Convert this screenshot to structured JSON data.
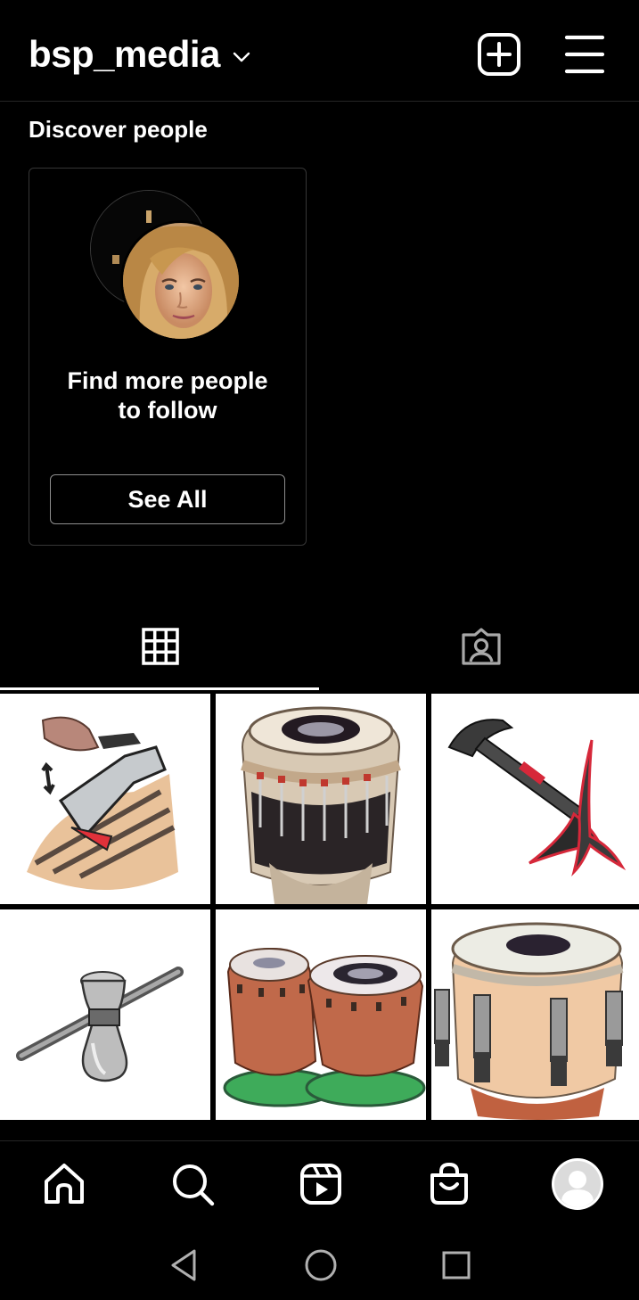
{
  "header": {
    "username": "bsp_media",
    "account_chevron_icon": "chevron-down-icon",
    "new_post_icon": "plus-square-icon",
    "menu_icon": "hamburger-menu-icon"
  },
  "discover": {
    "title": "Discover people",
    "card": {
      "text_line1": "Find more people",
      "text_line2": "to follow",
      "see_all_label": "See All"
    }
  },
  "tabs": [
    {
      "name": "posts-grid",
      "icon": "grid-icon",
      "active": true
    },
    {
      "name": "tagged",
      "icon": "tagged-person-icon",
      "active": false
    }
  ],
  "posts": [
    {
      "subject": "hand-tool-drawing"
    },
    {
      "subject": "tabla-drum-with-clamps"
    },
    {
      "subject": "hammer-drawing"
    },
    {
      "subject": "tuning-key-drawing"
    },
    {
      "subject": "pair-of-tabla-drums"
    },
    {
      "subject": "drum-with-clamps-drawing"
    }
  ],
  "bottom_nav": [
    {
      "name": "home",
      "icon": "home-icon"
    },
    {
      "name": "search",
      "icon": "search-icon"
    },
    {
      "name": "reels",
      "icon": "reels-icon"
    },
    {
      "name": "shop",
      "icon": "shopping-bag-icon"
    },
    {
      "name": "profile",
      "icon": "avatar-icon"
    }
  ],
  "system_nav": [
    {
      "name": "back",
      "icon": "back-triangle-icon"
    },
    {
      "name": "home",
      "icon": "home-circle-icon"
    },
    {
      "name": "recents",
      "icon": "recents-square-icon"
    }
  ],
  "colors": {
    "background": "#000000",
    "text": "#ffffff",
    "border": "#363636",
    "accent_red": "#d6283a"
  }
}
